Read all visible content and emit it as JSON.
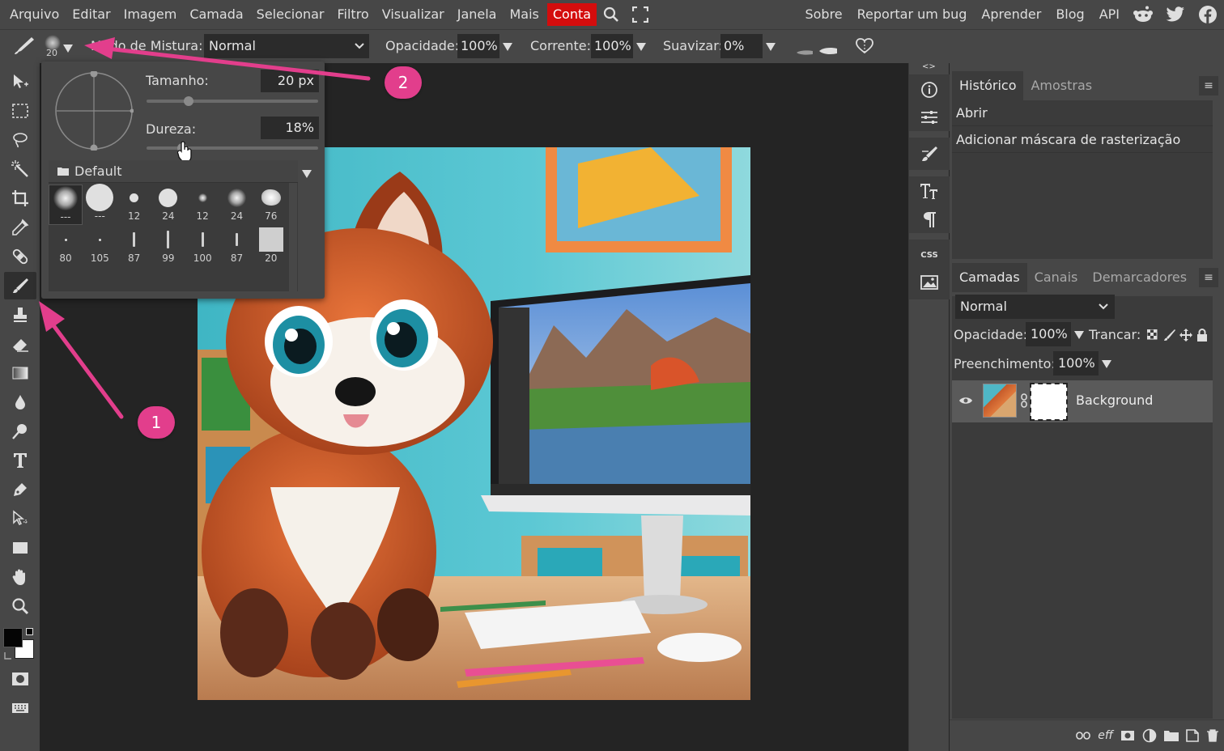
{
  "menu": {
    "items": [
      "Arquivo",
      "Editar",
      "Imagem",
      "Camada",
      "Selecionar",
      "Filtro",
      "Visualizar",
      "Janela",
      "Mais"
    ],
    "account": "Conta",
    "right": [
      "Sobre",
      "Reportar um bug",
      "Aprender",
      "Blog",
      "API"
    ]
  },
  "options": {
    "brush_size": "20",
    "blend_label": "Modo de Mistura:",
    "blend_value": "Normal",
    "opacity_label": "Opacidade:",
    "opacity_value": "100%",
    "flow_label": "Corrente:",
    "flow_value": "100%",
    "smooth_label": "Suavizar:",
    "smooth_value": "0%"
  },
  "brush_popup": {
    "size_label": "Tamanho:",
    "size_value": "20 px",
    "size_fraction": 0.15,
    "hardness_label": "Dureza:",
    "hardness_value": "18%",
    "hardness_fraction": 0.18,
    "folder": "Default",
    "presets": [
      {
        "label": "---",
        "kind": "soft",
        "d": 30
      },
      {
        "label": "---",
        "kind": "hard",
        "d": 34
      },
      {
        "label": "12",
        "kind": "hard",
        "d": 11
      },
      {
        "label": "24",
        "kind": "hard",
        "d": 23
      },
      {
        "label": "12",
        "kind": "soft",
        "d": 11
      },
      {
        "label": "24",
        "kind": "soft",
        "d": 23
      },
      {
        "label": "76",
        "kind": "cloud",
        "d": 24
      },
      {
        "label": "80",
        "kind": "dot",
        "d": 3
      },
      {
        "label": "105",
        "kind": "dot",
        "d": 3
      },
      {
        "label": "87",
        "kind": "bar",
        "d": 18
      },
      {
        "label": "99",
        "kind": "bar",
        "d": 22
      },
      {
        "label": "100",
        "kind": "bar",
        "d": 18
      },
      {
        "label": "87",
        "kind": "bar",
        "d": 16
      },
      {
        "label": "20",
        "kind": "square",
        "d": 30
      }
    ]
  },
  "history_panel": {
    "tabs": [
      "Histórico",
      "Amostras"
    ],
    "items": [
      "Abrir",
      "Adicionar máscara de rasterização"
    ]
  },
  "layers_panel": {
    "tabs": [
      "Camadas",
      "Canais",
      "Demarcadores"
    ],
    "blend": "Normal",
    "opacity_label": "Opacidade:",
    "opacity_value": "100%",
    "lock_label": "Trancar:",
    "fill_label": "Preenchimento:",
    "fill_value": "100%",
    "layer_name": "Background"
  },
  "annotations": {
    "badge1": "1",
    "badge2": "2",
    "color": "#e23e8c"
  },
  "colors": {
    "menu_bg": "#474747",
    "workspace": "#242424",
    "account": "#d40d0d"
  }
}
